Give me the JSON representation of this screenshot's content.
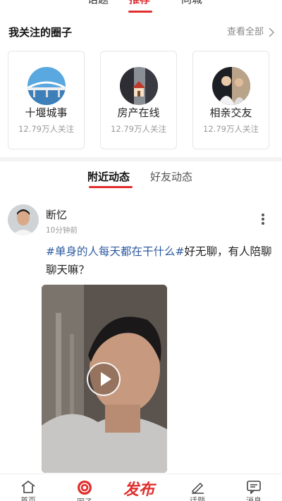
{
  "top_tabs": [
    {
      "label": "话题"
    },
    {
      "label": "推荐"
    },
    {
      "label": "同城"
    }
  ],
  "circles_section": {
    "title": "我关注的圈子",
    "view_all": "查看全部",
    "items": [
      {
        "name": "十堰城事",
        "followers": "12.79万人关注",
        "thumb": "bridge-photo"
      },
      {
        "name": "房产在线",
        "followers": "12.79万人关注",
        "thumb": "house-photo"
      },
      {
        "name": "相亲交友",
        "followers": "12.79万人关注",
        "thumb": "couple-photo"
      }
    ]
  },
  "feed_tabs": [
    {
      "label": "附近动态",
      "active": true
    },
    {
      "label": "好友动态",
      "active": false
    }
  ],
  "post": {
    "author": "断忆",
    "time": "10分钟前",
    "hashtag1": "#单身的人每天都在干什么#",
    "text": "好无聊，有人陪聊聊天嘛？",
    "media": "video",
    "more_icon": "more-vertical-icon"
  },
  "bottom_nav": [
    {
      "label": "首页",
      "icon": "home-icon"
    },
    {
      "label": "圈子",
      "icon": "circle-icon"
    },
    {
      "label": "发布",
      "icon": "publish-icon"
    },
    {
      "label": "话题",
      "icon": "edit-icon"
    },
    {
      "label": "消息",
      "icon": "message-icon"
    }
  ],
  "colors": {
    "accent": "#e12e2e",
    "hashtag": "#2c5aa0"
  }
}
